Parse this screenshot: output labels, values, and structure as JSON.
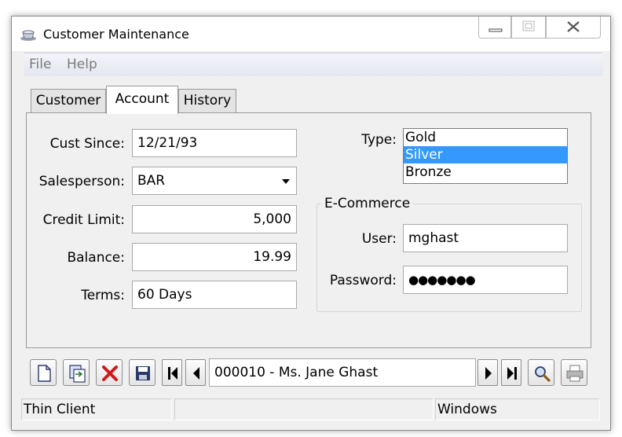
{
  "window": {
    "title": "Customer Maintenance"
  },
  "menu": {
    "file": "File",
    "help": "Help"
  },
  "tabs": [
    {
      "label": "Customer"
    },
    {
      "label": "Account"
    },
    {
      "label": "History"
    }
  ],
  "account": {
    "cust_since_label": "Cust Since:",
    "cust_since_value": "12/21/93",
    "salesperson_label": "Salesperson:",
    "salesperson_value": "BAR",
    "credit_limit_label": "Credit Limit:",
    "credit_limit_value": "5,000",
    "balance_label": "Balance:",
    "balance_value": "19.99",
    "terms_label": "Terms:",
    "terms_value": "60 Days",
    "type_label": "Type:",
    "type_options": [
      "Gold",
      "Silver",
      "Bronze"
    ],
    "type_selected": "Silver"
  },
  "ecommerce": {
    "title": "E-Commerce",
    "user_label": "User:",
    "user_value": "mghast",
    "password_label": "Password:",
    "password_value": "●●●●●●●"
  },
  "toolbar": {
    "record": "000010 - Ms. Jane Ghast",
    "icons": [
      "new-icon",
      "copy-record-icon",
      "delete-icon",
      "save-icon",
      "first-record-icon",
      "prev-record-icon",
      "next-record-icon",
      "last-record-icon",
      "search-icon",
      "print-icon"
    ]
  },
  "status": {
    "left": "Thin Client",
    "middle": "",
    "right": "Windows"
  },
  "colors": {
    "selection": "#3399ff",
    "delete": "#d11a1a"
  }
}
